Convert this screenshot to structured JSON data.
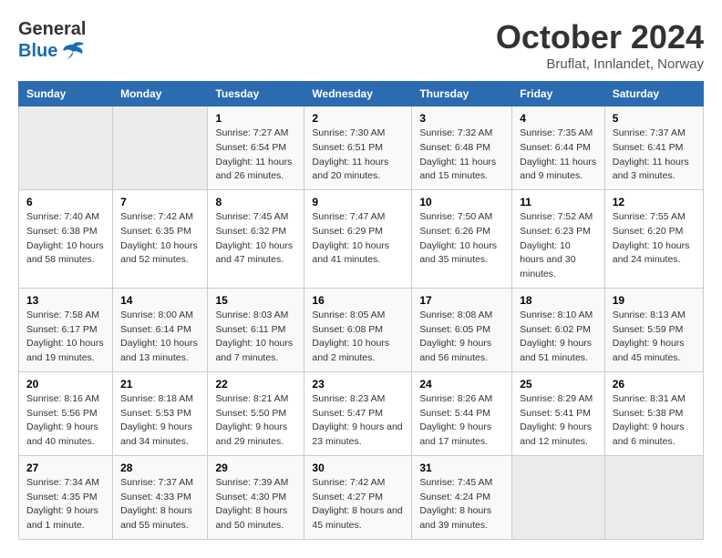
{
  "logo": {
    "text_general": "General",
    "text_blue": "Blue"
  },
  "title": "October 2024",
  "subtitle": "Bruflat, Innlandet, Norway",
  "weekdays": [
    "Sunday",
    "Monday",
    "Tuesday",
    "Wednesday",
    "Thursday",
    "Friday",
    "Saturday"
  ],
  "weeks": [
    [
      {
        "day": "",
        "sunrise": "",
        "sunset": "",
        "daylight": ""
      },
      {
        "day": "",
        "sunrise": "",
        "sunset": "",
        "daylight": ""
      },
      {
        "day": "1",
        "sunrise": "Sunrise: 7:27 AM",
        "sunset": "Sunset: 6:54 PM",
        "daylight": "Daylight: 11 hours and 26 minutes."
      },
      {
        "day": "2",
        "sunrise": "Sunrise: 7:30 AM",
        "sunset": "Sunset: 6:51 PM",
        "daylight": "Daylight: 11 hours and 20 minutes."
      },
      {
        "day": "3",
        "sunrise": "Sunrise: 7:32 AM",
        "sunset": "Sunset: 6:48 PM",
        "daylight": "Daylight: 11 hours and 15 minutes."
      },
      {
        "day": "4",
        "sunrise": "Sunrise: 7:35 AM",
        "sunset": "Sunset: 6:44 PM",
        "daylight": "Daylight: 11 hours and 9 minutes."
      },
      {
        "day": "5",
        "sunrise": "Sunrise: 7:37 AM",
        "sunset": "Sunset: 6:41 PM",
        "daylight": "Daylight: 11 hours and 3 minutes."
      }
    ],
    [
      {
        "day": "6",
        "sunrise": "Sunrise: 7:40 AM",
        "sunset": "Sunset: 6:38 PM",
        "daylight": "Daylight: 10 hours and 58 minutes."
      },
      {
        "day": "7",
        "sunrise": "Sunrise: 7:42 AM",
        "sunset": "Sunset: 6:35 PM",
        "daylight": "Daylight: 10 hours and 52 minutes."
      },
      {
        "day": "8",
        "sunrise": "Sunrise: 7:45 AM",
        "sunset": "Sunset: 6:32 PM",
        "daylight": "Daylight: 10 hours and 47 minutes."
      },
      {
        "day": "9",
        "sunrise": "Sunrise: 7:47 AM",
        "sunset": "Sunset: 6:29 PM",
        "daylight": "Daylight: 10 hours and 41 minutes."
      },
      {
        "day": "10",
        "sunrise": "Sunrise: 7:50 AM",
        "sunset": "Sunset: 6:26 PM",
        "daylight": "Daylight: 10 hours and 35 minutes."
      },
      {
        "day": "11",
        "sunrise": "Sunrise: 7:52 AM",
        "sunset": "Sunset: 6:23 PM",
        "daylight": "Daylight: 10 hours and 30 minutes."
      },
      {
        "day": "12",
        "sunrise": "Sunrise: 7:55 AM",
        "sunset": "Sunset: 6:20 PM",
        "daylight": "Daylight: 10 hours and 24 minutes."
      }
    ],
    [
      {
        "day": "13",
        "sunrise": "Sunrise: 7:58 AM",
        "sunset": "Sunset: 6:17 PM",
        "daylight": "Daylight: 10 hours and 19 minutes."
      },
      {
        "day": "14",
        "sunrise": "Sunrise: 8:00 AM",
        "sunset": "Sunset: 6:14 PM",
        "daylight": "Daylight: 10 hours and 13 minutes."
      },
      {
        "day": "15",
        "sunrise": "Sunrise: 8:03 AM",
        "sunset": "Sunset: 6:11 PM",
        "daylight": "Daylight: 10 hours and 7 minutes."
      },
      {
        "day": "16",
        "sunrise": "Sunrise: 8:05 AM",
        "sunset": "Sunset: 6:08 PM",
        "daylight": "Daylight: 10 hours and 2 minutes."
      },
      {
        "day": "17",
        "sunrise": "Sunrise: 8:08 AM",
        "sunset": "Sunset: 6:05 PM",
        "daylight": "Daylight: 9 hours and 56 minutes."
      },
      {
        "day": "18",
        "sunrise": "Sunrise: 8:10 AM",
        "sunset": "Sunset: 6:02 PM",
        "daylight": "Daylight: 9 hours and 51 minutes."
      },
      {
        "day": "19",
        "sunrise": "Sunrise: 8:13 AM",
        "sunset": "Sunset: 5:59 PM",
        "daylight": "Daylight: 9 hours and 45 minutes."
      }
    ],
    [
      {
        "day": "20",
        "sunrise": "Sunrise: 8:16 AM",
        "sunset": "Sunset: 5:56 PM",
        "daylight": "Daylight: 9 hours and 40 minutes."
      },
      {
        "day": "21",
        "sunrise": "Sunrise: 8:18 AM",
        "sunset": "Sunset: 5:53 PM",
        "daylight": "Daylight: 9 hours and 34 minutes."
      },
      {
        "day": "22",
        "sunrise": "Sunrise: 8:21 AM",
        "sunset": "Sunset: 5:50 PM",
        "daylight": "Daylight: 9 hours and 29 minutes."
      },
      {
        "day": "23",
        "sunrise": "Sunrise: 8:23 AM",
        "sunset": "Sunset: 5:47 PM",
        "daylight": "Daylight: 9 hours and 23 minutes."
      },
      {
        "day": "24",
        "sunrise": "Sunrise: 8:26 AM",
        "sunset": "Sunset: 5:44 PM",
        "daylight": "Daylight: 9 hours and 17 minutes."
      },
      {
        "day": "25",
        "sunrise": "Sunrise: 8:29 AM",
        "sunset": "Sunset: 5:41 PM",
        "daylight": "Daylight: 9 hours and 12 minutes."
      },
      {
        "day": "26",
        "sunrise": "Sunrise: 8:31 AM",
        "sunset": "Sunset: 5:38 PM",
        "daylight": "Daylight: 9 hours and 6 minutes."
      }
    ],
    [
      {
        "day": "27",
        "sunrise": "Sunrise: 7:34 AM",
        "sunset": "Sunset: 4:35 PM",
        "daylight": "Daylight: 9 hours and 1 minute."
      },
      {
        "day": "28",
        "sunrise": "Sunrise: 7:37 AM",
        "sunset": "Sunset: 4:33 PM",
        "daylight": "Daylight: 8 hours and 55 minutes."
      },
      {
        "day": "29",
        "sunrise": "Sunrise: 7:39 AM",
        "sunset": "Sunset: 4:30 PM",
        "daylight": "Daylight: 8 hours and 50 minutes."
      },
      {
        "day": "30",
        "sunrise": "Sunrise: 7:42 AM",
        "sunset": "Sunset: 4:27 PM",
        "daylight": "Daylight: 8 hours and 45 minutes."
      },
      {
        "day": "31",
        "sunrise": "Sunrise: 7:45 AM",
        "sunset": "Sunset: 4:24 PM",
        "daylight": "Daylight: 8 hours and 39 minutes."
      },
      {
        "day": "",
        "sunrise": "",
        "sunset": "",
        "daylight": ""
      },
      {
        "day": "",
        "sunrise": "",
        "sunset": "",
        "daylight": ""
      }
    ]
  ]
}
